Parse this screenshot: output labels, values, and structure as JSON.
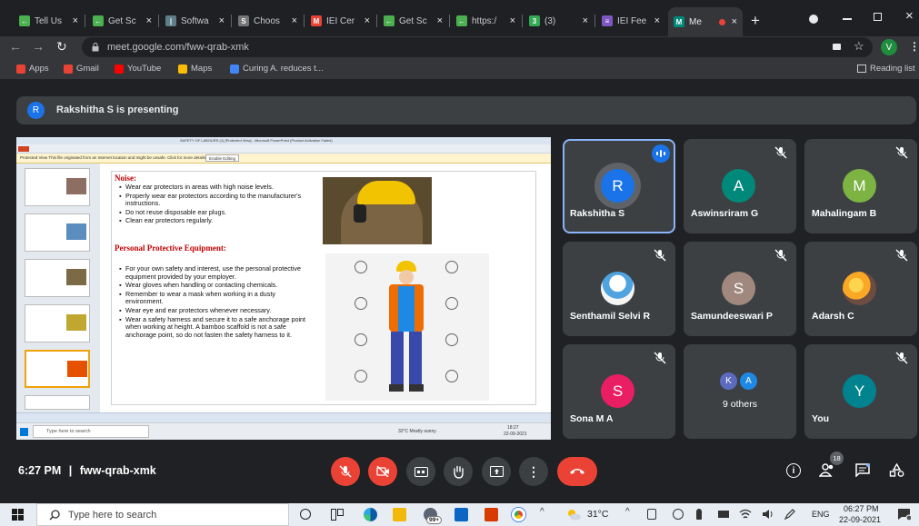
{
  "tabs": [
    {
      "label": "Tell Us",
      "favicon_color": "#4caf50",
      "glyph": "←"
    },
    {
      "label": "Get Sc",
      "favicon_color": "#4caf50",
      "glyph": "←"
    },
    {
      "label": "Softwa",
      "favicon_color": "#607d8b",
      "glyph": "|"
    },
    {
      "label": "Choos",
      "favicon_color": "#757575",
      "glyph": "S"
    },
    {
      "label": "IEI Cer",
      "favicon_color": "#ea4335",
      "glyph": "M"
    },
    {
      "label": "Get Sc",
      "favicon_color": "#4caf50",
      "glyph": "←"
    },
    {
      "label": "https:/",
      "favicon_color": "#4caf50",
      "glyph": "←"
    },
    {
      "label": "(3)",
      "favicon_color": "#34a853",
      "glyph": "3"
    },
    {
      "label": "IEI Fee",
      "favicon_color": "#7e57c2",
      "glyph": "≡"
    },
    {
      "label": "Me",
      "favicon_color": "#00897b",
      "glyph": "M",
      "active": true
    }
  ],
  "browser": {
    "url": "meet.google.com/fww-qrab-xmk",
    "profile_initial": "V",
    "reading_list": "Reading list"
  },
  "bookmarks": [
    {
      "label": "Apps",
      "icon": "apps-grid-icon",
      "color": "#ea4335"
    },
    {
      "label": "Gmail",
      "icon": "gmail-icon",
      "color": "#ea4335"
    },
    {
      "label": "YouTube",
      "icon": "youtube-icon",
      "color": "#ff0000"
    },
    {
      "label": "Maps",
      "icon": "maps-pin-icon",
      "color": "#fbbc04"
    },
    {
      "label": "Curing A. reduces t...",
      "icon": "google-g-icon",
      "color": "#4285f4"
    }
  ],
  "meet": {
    "presenter_initial": "R",
    "presenting_text": "Rakshitha S is presenting",
    "time": "6:27 PM",
    "separator": "|",
    "meeting_code": "fww-qrab-xmk",
    "people_count": "18",
    "tiles": [
      {
        "name": "Rakshitha S",
        "initial": "R",
        "color": "#1a73e8",
        "speaking": true
      },
      {
        "name": "Aswinsriram G",
        "initial": "A",
        "color": "#00897b"
      },
      {
        "name": "Mahalingam B",
        "initial": "M",
        "color": "#7cb342"
      },
      {
        "name": "Senthamil Selvi R",
        "initial": "",
        "color": "#e8f0fe",
        "photo": "smurf-avatar"
      },
      {
        "name": "Samundeeswari P",
        "initial": "S",
        "color": "#a1887f"
      },
      {
        "name": "Adarsh C",
        "initial": "",
        "color": "#f9a825",
        "photo": "flowers-avatar"
      },
      {
        "name": "Sona M A",
        "initial": "S",
        "color": "#e91e63"
      },
      {
        "name": "9 others",
        "initial": "",
        "color": "#3c4043",
        "others": [
          "K",
          "A"
        ]
      },
      {
        "name": "You",
        "initial": "Y",
        "color": "#00838f"
      }
    ]
  },
  "slide": {
    "ppt_title": "SAFETY OF LABOURS (1) [Protected View] - Microsoft PowerPoint (Product Activation Failed)",
    "protected_msg": "Protected View  This file originated from an Internet location and might be unsafe. Click for more details.",
    "enable_editing": "Enable Editing",
    "heading1": "Noise:",
    "noise_items": [
      "Wear ear protectors in areas with high noise levels.",
      "Properly wear ear protectors according to the manufacturer's instructions.",
      "Do not reuse disposable ear plugs.",
      "Clean ear protectors regularly."
    ],
    "heading2": "Personal Protective Equipment:",
    "ppe_items": [
      "For your own safety and interest, use the personal protective equipment provided by your employer.",
      "Wear gloves when handling or contacting chemicals.",
      "Remember to wear a mask when working in a dusty environment.",
      "Wear eye and ear protectors whenever necessary.",
      "Wear a safety harness and secure it to a safe anchorage point when working at height. A bamboo scaffold is not a safe anchorage point, so do not fasten the safety harness to it."
    ],
    "inner_search": "Type here to search",
    "inner_weather": "32°C Mostly sunny",
    "inner_time": "18:27",
    "inner_date": "22-09-2021"
  },
  "taskbar": {
    "search_placeholder": "Type here to search",
    "badge": "99+",
    "temperature": "31°C",
    "language": "ENG",
    "time": "06:27 PM",
    "date": "22-09-2021"
  }
}
